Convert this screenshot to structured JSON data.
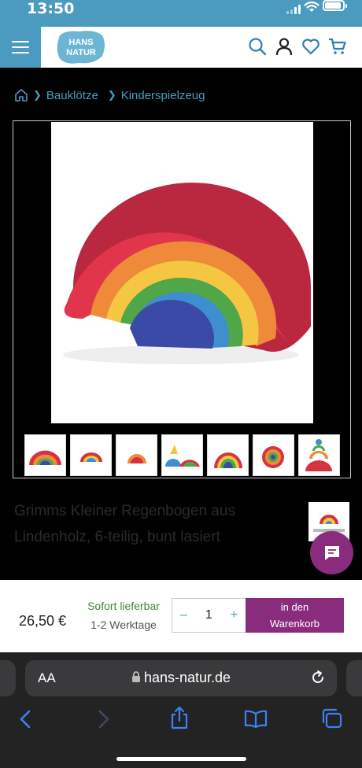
{
  "status_bar": {
    "time": "13:50"
  },
  "header": {
    "logo_line1": "HANS",
    "logo_line2": "NATUR",
    "icons": [
      "menu-icon",
      "search-icon",
      "account-icon",
      "wishlist-heart-icon",
      "cart-icon"
    ]
  },
  "breadcrumb": {
    "items": [
      {
        "label": "Bauklötze"
      },
      {
        "label": "Kinderspielzeug"
      }
    ]
  },
  "product": {
    "title": "Grimms Kleiner Regenbogen aus Lindenholz, 6-teilig, bunt lasiert",
    "thumbnail_count": 7
  },
  "purchase": {
    "price": "26,50 €",
    "availability": "Sofort lieferbar",
    "delivery_time": "1-2 Werktage",
    "quantity": "1",
    "decrement_label": "–",
    "increment_label": "+",
    "cart_button_line1": "in den",
    "cart_button_line2": "Warenkorb"
  },
  "browser": {
    "aa_label": "AA",
    "domain": "hans-natur.de"
  },
  "colors": {
    "brand_blue": "#4b9bc0",
    "accent_purple": "#8a2c7e",
    "in_stock_green": "#3b8a2e"
  }
}
